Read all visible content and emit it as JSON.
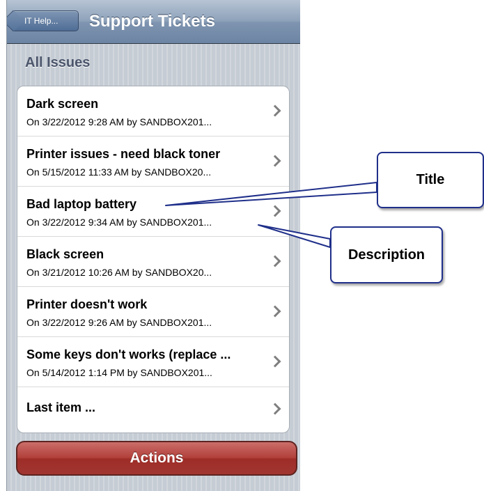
{
  "navbar": {
    "back_label": "IT Help...",
    "title": "Support Tickets"
  },
  "section": {
    "header": "All Issues"
  },
  "tickets": [
    {
      "title": "Dark screen",
      "description": "On 3/22/2012 9:28 AM by SANDBOX201..."
    },
    {
      "title": "Printer issues - need black toner",
      "description": "On 5/15/2012 11:33 AM by SANDBOX20..."
    },
    {
      "title": "Bad laptop battery",
      "description": "On 3/22/2012 9:34 AM by SANDBOX201..."
    },
    {
      "title": "Black screen",
      "description": "On 3/21/2012 10:26 AM by SANDBOX20..."
    },
    {
      "title": "Printer doesn't work",
      "description": "On 3/22/2012 9:26 AM by SANDBOX201..."
    },
    {
      "title": "Some keys don't works (replace ...",
      "description": "On 5/14/2012 1:14 PM by SANDBOX201..."
    },
    {
      "title": "Last item ...",
      "description": ""
    }
  ],
  "actions_label": "Actions",
  "annotations": {
    "title_callout": "Title",
    "description_callout": "Description",
    "border_color": "#1f2f8a"
  },
  "colors": {
    "navbar": "#7e94b0",
    "actions_button": "#b2403b",
    "section_header_text": "#4c566c"
  }
}
